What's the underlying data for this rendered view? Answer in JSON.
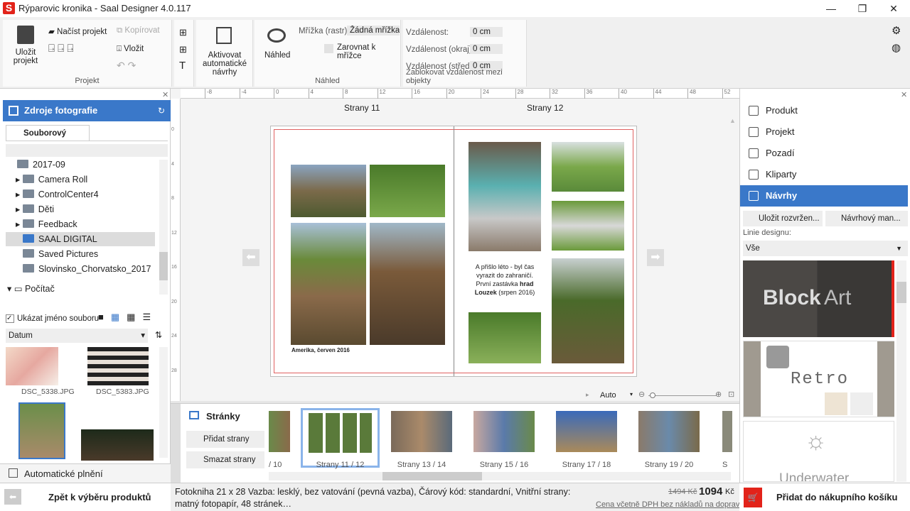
{
  "window": {
    "title": "Rýparovic kronika - Saal Designer 4.0.117",
    "logo": "S"
  },
  "ribbon": {
    "save": "Uložit projekt",
    "load": "Načíst projekt",
    "copy": "Kopírovat",
    "paste": "Vložit",
    "group_project": "Projekt",
    "auto_designs": "Aktivovat automatické návrhy",
    "preview": "Náhled",
    "grid_label": "Mřížka (rastr):",
    "grid_value": "Žádná mřížka",
    "snap": "Zarovnat k mřížce",
    "group_preview": "Náhled",
    "dist": "Vzdálenost:",
    "dist_edge": "Vzdálenost (okraj):",
    "dist_center": "Vzdálenost (střed):",
    "dist_value": "0 cm",
    "group_lock": "Zablokovat vzdálenost mezi objekty"
  },
  "left": {
    "header": "Zdroje fotografie",
    "tab": "Souborový systém",
    "folders": [
      "2017-09",
      "Camera Roll",
      "ControlCenter4",
      "Děti",
      "Feedback",
      "SAAL DIGITAL",
      "Saved Pictures",
      "Slovinsko_Chorvatsko_2017"
    ],
    "computer": "Počítač",
    "show_name": "Ukázat jméno souboru",
    "sort": "Datum",
    "photos": [
      "DSC_5338.JPG",
      "DSC_5383.JPG"
    ],
    "auto_fill": "Automatické plnění"
  },
  "canvas": {
    "ruler": [
      "-8",
      "-4",
      "0",
      "4",
      "8",
      "12",
      "16",
      "20",
      "24",
      "28",
      "32",
      "36",
      "40",
      "44",
      "48",
      "52"
    ],
    "vruler": [
      "0",
      "4",
      "8",
      "12",
      "16",
      "20",
      "24",
      "28"
    ],
    "left_page": "Strany 11",
    "right_page": "Strany 12",
    "caption": "Amerika, červen 2016",
    "text1": "A přišlo léto - byl čas vyrazit do zahraničí. První zastávka ",
    "text_bold1": "hrad Louzek",
    "text2": " (srpen 2016)",
    "zoom": "Auto"
  },
  "strip": {
    "title": "Stránky",
    "add": "Přidat strany",
    "delete": "Smazat strany",
    "thumbs": [
      "/ 10",
      "Strany 11 / 12",
      "Strany 13 / 14",
      "Strany 15 / 16",
      "Strany 17 / 18",
      "Strany 19 / 20",
      "S"
    ]
  },
  "right": {
    "items": [
      "Produkt",
      "Projekt",
      "Pozadí",
      "Kliparty",
      "Návrhy"
    ],
    "save_layout": "Uložit rozvržen...",
    "design_manager": "Návrhový man...",
    "line_label": "Linie designu:",
    "line_value": "Vše",
    "designs": [
      "Block",
      "Art",
      "Retro",
      "Underwater"
    ]
  },
  "bottom": {
    "back": "Zpět k výběru produktů",
    "desc": "Fotokniha 21 x 28 Vazba: lesklý, bez vatování (pevná vazba), Čárový kód: standardní, Vnitřní strany: matný fotopapír, 48 stránek…",
    "old_price": "1494 Kč",
    "price": "1094",
    "currency": "Kč",
    "price_note": "Cena včetně DPH bez nákladů na dopravu",
    "cart": "Přidat do nákupního košíku"
  },
  "colors": {
    "accent": "#3a78c9",
    "brand": "#e2231a"
  }
}
